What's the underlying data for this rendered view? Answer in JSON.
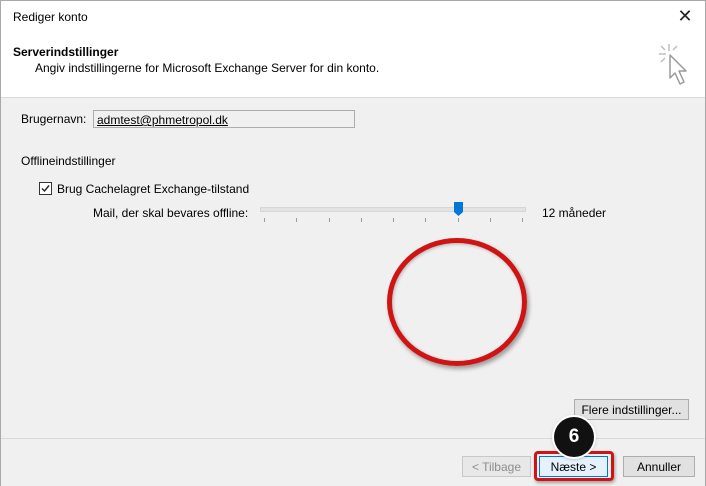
{
  "window": {
    "title": "Rediger konto"
  },
  "header": {
    "title": "Serverindstillinger",
    "subtitle": "Angiv indstillingerne for Microsoft Exchange Server for din konto."
  },
  "user": {
    "label": "Brugernavn:",
    "value": "admtest@phmetropol.dk"
  },
  "offline": {
    "section_label": "Offlineindstillinger",
    "cached_mode_label": "Brug Cachelagret Exchange-tilstand",
    "cached_mode_checked": true,
    "slider_label": "Mail, der skal bevares offline:",
    "slider_value_label": "12 måneder",
    "slider_position_fraction": 0.75
  },
  "buttons": {
    "more_settings": "Flere indstillinger...",
    "back": "< Tilbage",
    "next": "Næste >",
    "cancel": "Annuller"
  },
  "annotation": {
    "step_number": "6",
    "highlight_color": "#d01414"
  },
  "icons": {
    "close": "close-icon",
    "wizard": "wizard-cursor-icon",
    "checkbox": "checkmark-icon"
  }
}
